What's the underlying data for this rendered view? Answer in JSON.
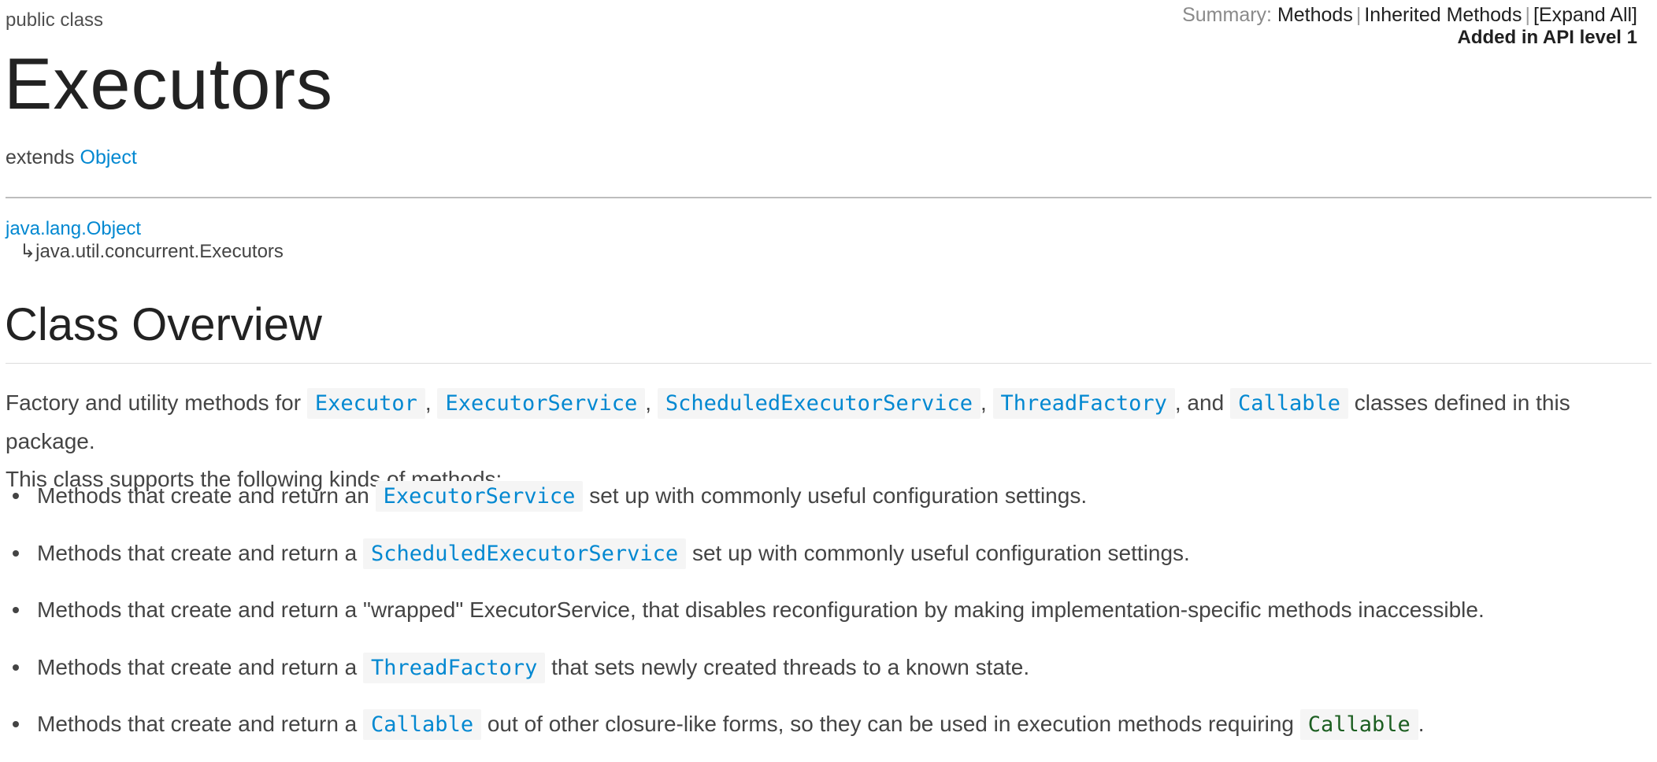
{
  "header": {
    "modifier": "public class",
    "title": "Executors",
    "extends_label": "extends",
    "extends_link": "Object",
    "summary": {
      "label": "Summary:",
      "links": [
        "Methods",
        "Inherited Methods",
        "[Expand All]"
      ],
      "api_level": "Added in API level 1"
    }
  },
  "inheritance": {
    "parent": "java.lang.Object",
    "arrow": "↳",
    "child": "java.util.concurrent.Executors"
  },
  "overview": {
    "heading": "Class Overview",
    "intro_prefix": "Factory and utility methods for",
    "intro_codes": [
      "Executor",
      "ExecutorService",
      "ScheduledExecutorService",
      "ThreadFactory",
      "Callable"
    ],
    "intro_and": ", and",
    "intro_suffix": "classes defined in this package.",
    "intro_line2": "This class supports the following kinds of methods:",
    "items": [
      {
        "prefix": "Methods that create and return an",
        "code": "ExecutorService",
        "suffix": "set up with commonly useful configuration settings."
      },
      {
        "prefix": "Methods that create and return a",
        "code": "ScheduledExecutorService",
        "suffix": "set up with commonly useful configuration settings."
      },
      {
        "text": "Methods that create and return a \"wrapped\" ExecutorService, that disables reconfiguration by making implementation-specific methods inaccessible."
      },
      {
        "prefix": "Methods that create and return a",
        "code": "ThreadFactory",
        "suffix": "that sets newly created threads to a known state."
      },
      {
        "prefix": "Methods that create and return a",
        "code": "Callable",
        "suffix": "out of other closure-like forms, so they can be used in execution methods requiring",
        "code2": "Callable",
        "end": "."
      }
    ]
  },
  "colors": {
    "link": "#0288d1",
    "code_bg": "#f5f5f5",
    "code_green": "#1b5e20",
    "text": "#444444",
    "heading": "#222222"
  }
}
